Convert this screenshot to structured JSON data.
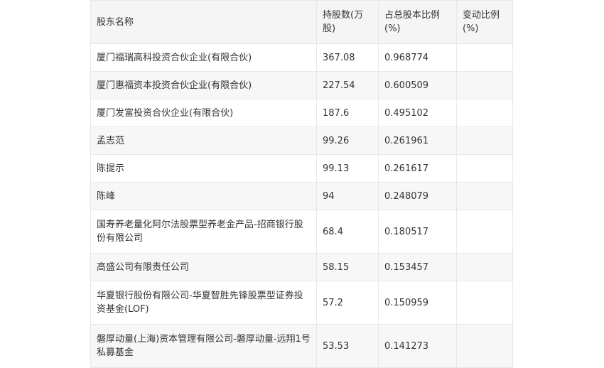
{
  "table": {
    "headers": [
      "股东名称",
      "持股数(万股)",
      "占总股本比例(%)",
      "变动比例(%)"
    ],
    "rows": [
      [
        "厦门福瑞高科投资合伙企业(有限合伙)",
        "367.08",
        "0.968774",
        ""
      ],
      [
        "厦门惠福资本投资合伙企业(有限合伙)",
        "227.54",
        "0.600509",
        ""
      ],
      [
        "厦门发富投资合伙企业(有限合伙)",
        "187.6",
        "0.495102",
        ""
      ],
      [
        "孟志范",
        "99.26",
        "0.261961",
        ""
      ],
      [
        "陈提示",
        "99.13",
        "0.261617",
        ""
      ],
      [
        "陈峰",
        "94",
        "0.248079",
        ""
      ],
      [
        "国寿养老量化阿尔法股票型养老金产品-招商银行股份有限公司",
        "68.4",
        "0.180517",
        ""
      ],
      [
        "高盛公司有限责任公司",
        "58.15",
        "0.153457",
        ""
      ],
      [
        "华夏银行股份有限公司-华夏智胜先锋股票型证券投资基金(LOF)",
        "57.2",
        "0.150959",
        ""
      ],
      [
        "磐厚动量(上海)资本管理有限公司-磐厚动量-远翔1号私募基金",
        "53.53",
        "0.141273",
        ""
      ]
    ]
  }
}
